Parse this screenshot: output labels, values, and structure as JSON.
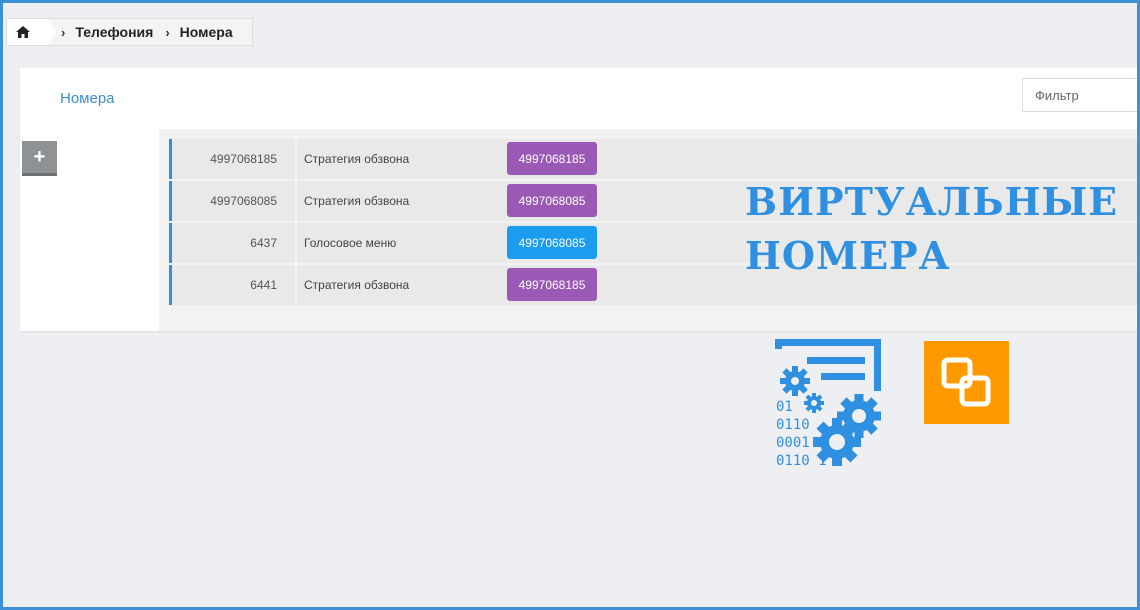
{
  "breadcrumb": {
    "items": [
      "Телефония",
      "Номера"
    ]
  },
  "panel": {
    "title": "Номера",
    "filter_placeholder": "Фильтр",
    "add_label": "+"
  },
  "rows": [
    {
      "number": "4997068185",
      "type": "Стратегия обзвона",
      "badge": "4997068185",
      "badge_color": "#9b59b6"
    },
    {
      "number": "4997068085",
      "type": "Стратегия обзвона",
      "badge": "4997068085",
      "badge_color": "#9b59b6"
    },
    {
      "number": "6437",
      "type": "Голосовое меню",
      "badge": "4997068085",
      "badge_color": "#1a9cf0"
    },
    {
      "number": "6441",
      "type": "Стратегия обзвона",
      "badge": "4997068185",
      "badge_color": "#9b59b6"
    }
  ],
  "overlay": {
    "line1": "ВИРТУАЛЬНЫЕ",
    "line2": "НОМЕРА",
    "binary": [
      "01",
      "0110",
      "0001",
      "0110 1"
    ]
  },
  "colors": {
    "accent": "#2f8fe0",
    "orange": "#ff9900",
    "frame": "#3d8fd6"
  },
  "icons": {
    "home": "home-icon",
    "config": "config-gears-icon",
    "link": "link-icon"
  }
}
